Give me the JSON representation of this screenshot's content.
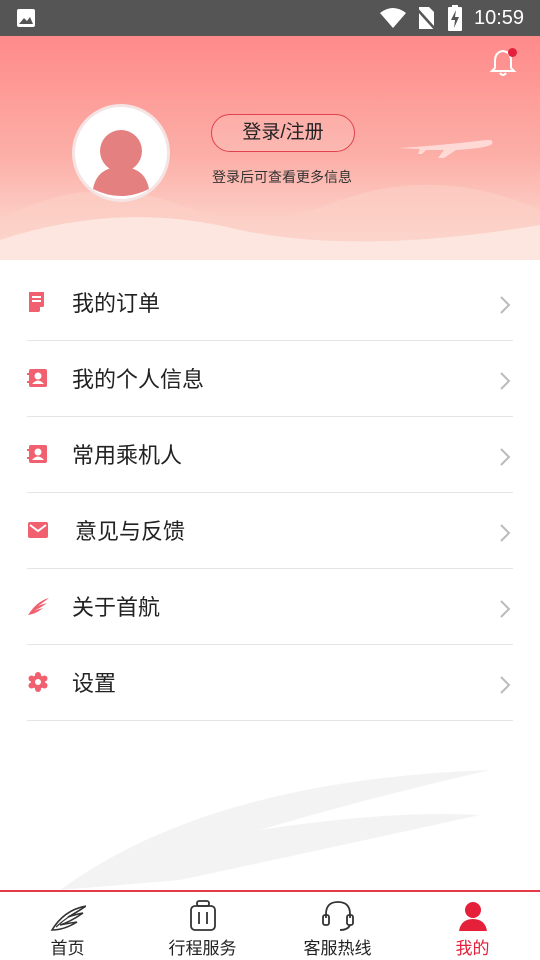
{
  "status_bar": {
    "time": "10:59"
  },
  "header": {
    "login_button": "登录/注册",
    "login_hint": "登录后可查看更多信息",
    "notification_badge": true
  },
  "menu": {
    "items": [
      {
        "label": "我的订单",
        "icon": "order-icon"
      },
      {
        "label": "我的个人信息",
        "icon": "contact-card-icon"
      },
      {
        "label": "常用乘机人",
        "icon": "contact-card-icon"
      },
      {
        "label": "意见与反馈",
        "icon": "mail-icon"
      },
      {
        "label": "关于首航",
        "icon": "airline-logo-icon"
      },
      {
        "label": "设置",
        "icon": "gear-icon"
      }
    ]
  },
  "tabbar": {
    "tabs": [
      {
        "label": "首页",
        "icon": "airline-logo-icon",
        "active": false
      },
      {
        "label": "行程服务",
        "icon": "luggage-icon",
        "active": false
      },
      {
        "label": "客服热线",
        "icon": "headset-icon",
        "active": false
      },
      {
        "label": "我的",
        "icon": "user-icon",
        "active": true
      }
    ]
  },
  "colors": {
    "accent": "#e5203a",
    "icon_red": "#f0606e",
    "header_top": "#ff8a8a"
  }
}
